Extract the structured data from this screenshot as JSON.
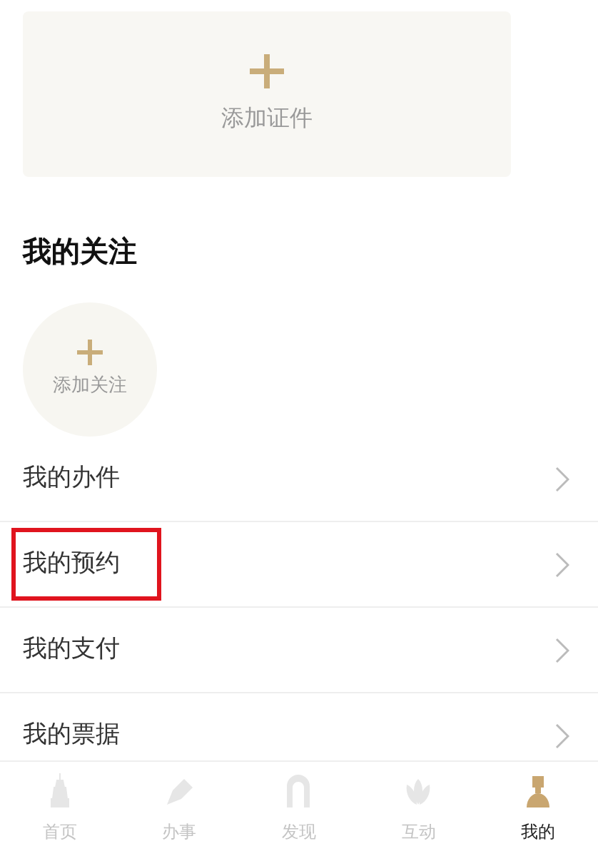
{
  "add_document_card": {
    "label": "添加证件"
  },
  "follow_section": {
    "title": "我的关注",
    "add_follow": {
      "label": "添加关注"
    }
  },
  "menu_items": [
    {
      "label": "我的办件",
      "highlighted": false
    },
    {
      "label": "我的预约",
      "highlighted": true
    },
    {
      "label": "我的支付",
      "highlighted": false
    },
    {
      "label": "我的票据",
      "highlighted": false
    }
  ],
  "tab_bar": [
    {
      "label": "首页",
      "kind": "home",
      "selected": false
    },
    {
      "label": "办事",
      "kind": "services",
      "selected": false
    },
    {
      "label": "发现",
      "kind": "discover",
      "selected": false
    },
    {
      "label": "互动",
      "kind": "interact",
      "selected": false
    },
    {
      "label": "我的",
      "kind": "profile",
      "selected": true
    }
  ]
}
